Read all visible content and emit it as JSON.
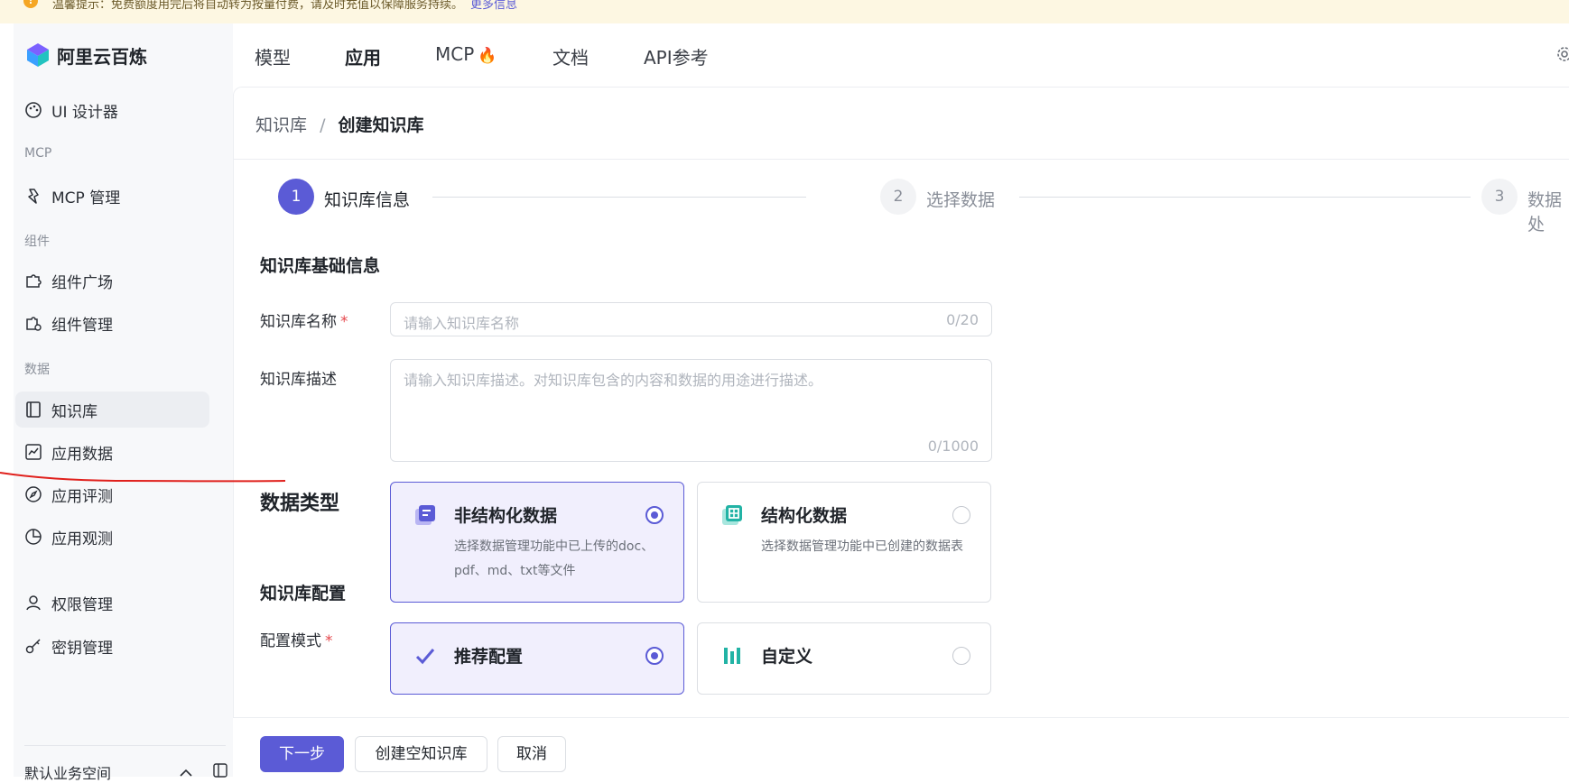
{
  "notice": {
    "text": "温馨提示：免费额度用完后将自动转为按量付费，请及时充值以保障服务持续。",
    "more_link": "更多信息"
  },
  "app": {
    "name": "阿里云百炼"
  },
  "topnav": {
    "items": [
      {
        "label": "模型"
      },
      {
        "label": "应用"
      },
      {
        "label": "MCP"
      },
      {
        "label": "文档"
      },
      {
        "label": "API参考"
      }
    ],
    "active": "应用",
    "mcp_badge": "🔥"
  },
  "sidebar": {
    "items": {
      "ui_designer": "UI 设计器",
      "mcp_manage": "MCP 管理",
      "component_plaza": "组件广场",
      "component_manage": "组件管理",
      "knowledge_base": "知识库",
      "app_data": "应用数据",
      "app_eval": "应用评测",
      "app_observe": "应用观测",
      "permissions": "权限管理",
      "keys": "密钥管理"
    },
    "groups": {
      "mcp": "MCP",
      "components": "组件",
      "data": "数据"
    },
    "active_item": "知识库",
    "workspace": "默认业务空间"
  },
  "breadcrumb": {
    "parent": "知识库",
    "separator": "/",
    "current": "创建知识库"
  },
  "steps": [
    {
      "num": "1",
      "label": "知识库信息",
      "state": "active"
    },
    {
      "num": "2",
      "label": "选择数据",
      "state": "todo"
    },
    {
      "num": "3",
      "label": "数据处",
      "state": "todo"
    }
  ],
  "form": {
    "basic_title": "知识库基础信息",
    "name": {
      "label": "知识库名称",
      "required": "*",
      "placeholder": "请输入知识库名称",
      "counter": "0/20"
    },
    "desc": {
      "label": "知识库描述",
      "placeholder": "请输入知识库描述。对知识库包含的内容和数据的用途进行描述。",
      "counter": "0/1000"
    },
    "data_type": {
      "label": "数据类型",
      "options": [
        {
          "title": "非结构化数据",
          "desc": "选择数据管理功能中已上传的doc、pdf、md、txt等文件",
          "selected": true
        },
        {
          "title": "结构化数据",
          "desc": "选择数据管理功能中已创建的数据表",
          "selected": false
        }
      ]
    },
    "config_title": "知识库配置",
    "config_mode": {
      "label": "配置模式",
      "required": "*",
      "options": [
        {
          "title": "推荐配置",
          "selected": true
        },
        {
          "title": "自定义",
          "selected": false
        }
      ]
    }
  },
  "footer": {
    "next": "下一步",
    "create_empty": "创建空知识库",
    "cancel": "取消"
  },
  "colors": {
    "accent": "#5b5bd6",
    "annotation": "#e0201c"
  }
}
